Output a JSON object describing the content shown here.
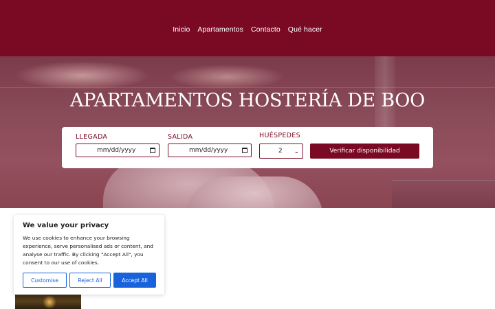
{
  "nav": {
    "items": [
      "Inicio",
      "Apartamentos",
      "Contacto",
      "Qué hacer"
    ]
  },
  "hero": {
    "title": "APARTAMENTOS HOSTERÍA DE BOO"
  },
  "booking": {
    "arrival_label": "LLEGADA",
    "arrival_value": "mm/dd/yyyy",
    "departure_label": "SALIDA",
    "departure_value": "mm/dd/yyyy",
    "guests_label": "HUÉSPEDES",
    "guests_value": "2",
    "check_button": "Verificar disponibilidad"
  },
  "cookie_banner": {
    "title": "We value your privacy",
    "text": "We use cookies to enhance your browsing experience, serve personalised ads or content, and analyse our traffic. By clicking \"Accept All\", you consent to our use of cookies.",
    "customise": "Customise",
    "reject": "Reject All",
    "accept": "Accept All"
  },
  "colors": {
    "brand": "#7a0a24",
    "cookie_accent": "#1863dc"
  },
  "icons": {
    "calendar": "calendar-icon",
    "select": "chevron-down-icon"
  }
}
